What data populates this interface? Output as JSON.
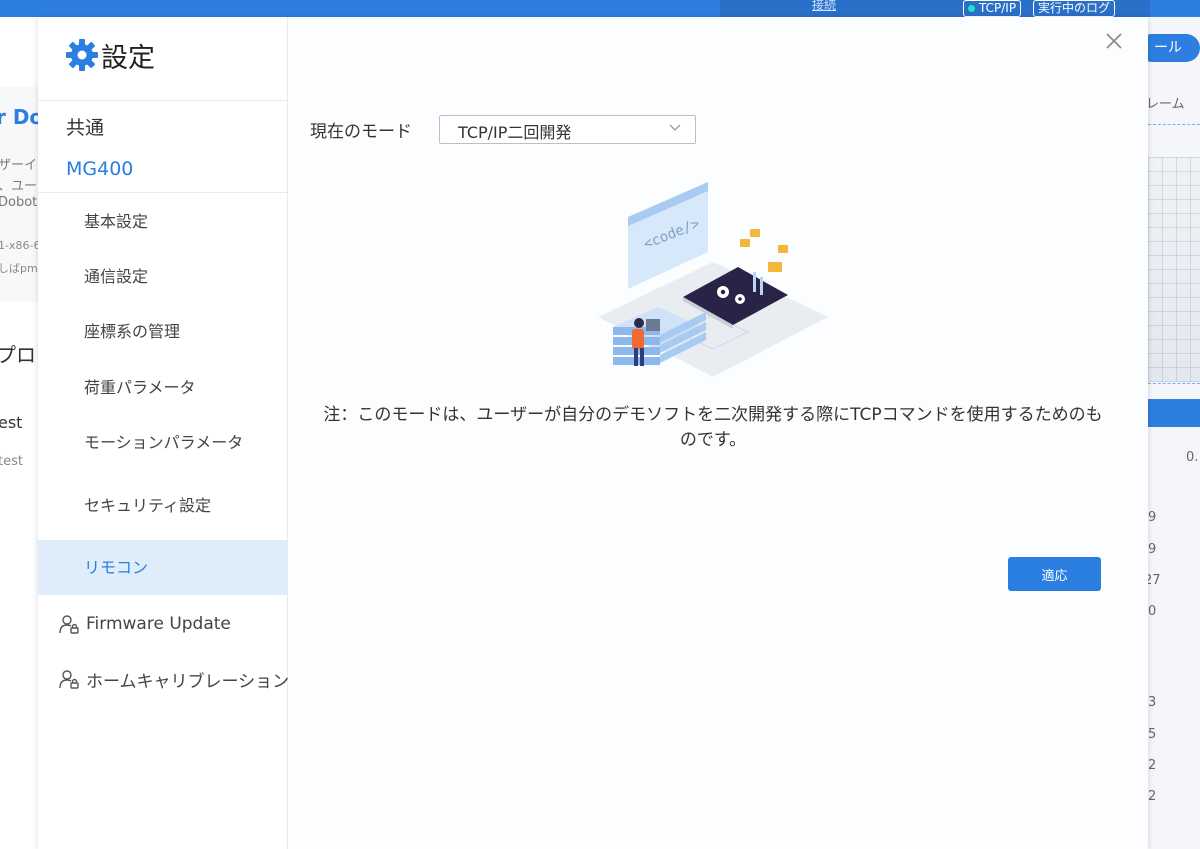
{
  "background": {
    "topbar_link": "接続",
    "chip_tcp": "TCP/IP",
    "chip_log": "実行中のログ",
    "left_fragments": [
      "r Do",
      "ザーイ",
      "、ユー",
      "Dobot",
      "1-x86-6",
      "しばpm@",
      "プロシ",
      "est",
      "test"
    ],
    "right_pill": "ール",
    "right_fragments": [
      "レーム",
      "0.",
      "9",
      "9",
      "27",
      "0",
      "3",
      "5",
      "2",
      "2"
    ]
  },
  "modal": {
    "title": "設定",
    "title_icon": "gear-icon",
    "sidebar": {
      "group_common": "共通",
      "group_device": "MG400",
      "items": [
        {
          "label": "基本設定"
        },
        {
          "label": "通信設定"
        },
        {
          "label": "座標系の管理"
        },
        {
          "label": "荷重パラメータ"
        },
        {
          "label": "モーションパラメータ"
        },
        {
          "label": "セキュリティ設定"
        },
        {
          "label": "リモコン",
          "active": true
        }
      ],
      "icon_items": [
        {
          "label": "Firmware Update",
          "icon": "user-lock-icon"
        },
        {
          "label": "ホームキャリブレーション",
          "icon": "user-lock-icon"
        }
      ]
    },
    "content": {
      "mode_label": "現在のモード",
      "mode_value": "TCP/IP二回開発",
      "illustration_text": "<code/>",
      "note": "注：このモードは、ユーザーが自分のデモソフトを二次開発する際にTCPコマンドを使用するためのものです。",
      "apply_label": "適応"
    },
    "colors": {
      "accent": "#2a7fe0",
      "active_bg": "#dfedfb"
    }
  }
}
